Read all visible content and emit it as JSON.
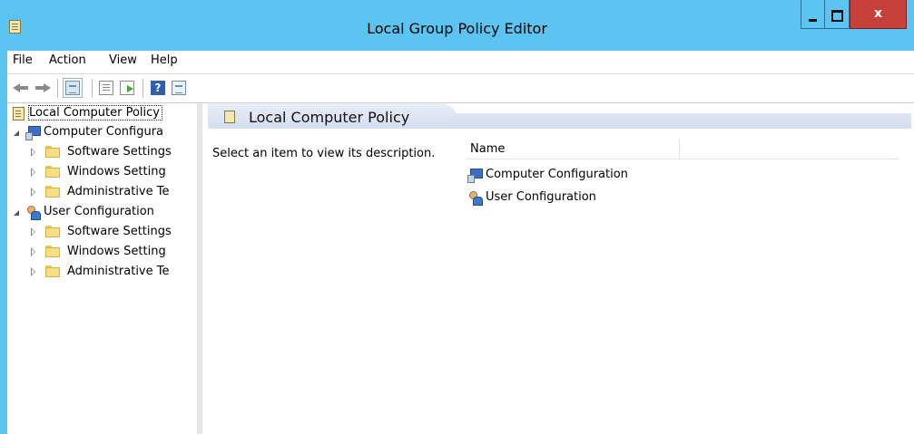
{
  "window": {
    "title": "Local Group Policy Editor",
    "close_glyph": "x",
    "icon": "policy-icon"
  },
  "menu": [
    "File",
    "Action",
    "View",
    "Help"
  ],
  "toolbar": {
    "buttons": [
      "back-icon",
      "forward-icon",
      "show-hide-console-tree-icon",
      "properties-icon",
      "export-list-icon",
      "help-icon",
      "show-hide-action-pane-icon"
    ],
    "help_glyph": "?"
  },
  "tree": {
    "root": "Local Computer Policy",
    "computer": "Computer Configura",
    "user": "User Configuration",
    "children": [
      "Software Settings",
      "Windows Setting",
      "Administrative Te"
    ]
  },
  "content": {
    "header_title": "Local Computer Policy",
    "description": "Select an item to view its description.",
    "column": "Name",
    "items": [
      "Computer Configuration",
      "User Configuration"
    ]
  }
}
